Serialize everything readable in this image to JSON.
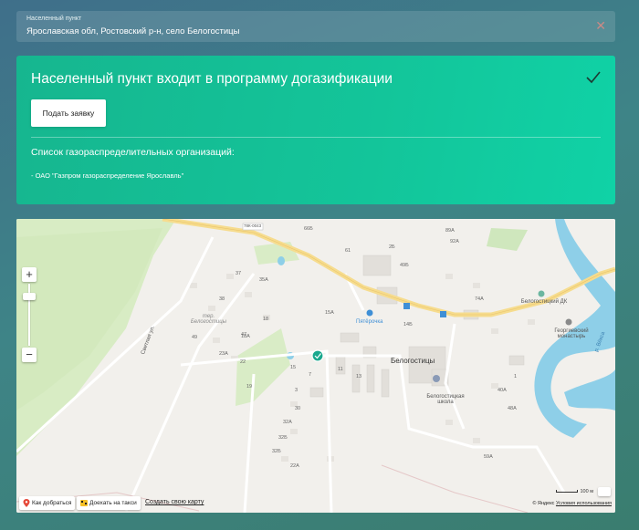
{
  "settlement": {
    "label": "Населенный пункт",
    "value": "Ярославская обл, Ростовский р-н, село Белогостицы",
    "close_icon": "close-icon"
  },
  "program": {
    "title": "Населенный пункт входит в программу догазификации",
    "apply_button": "Подать заявку",
    "list_title": "Список газораспределительных организаций:",
    "organizations": [
      "- ОАО \"Газпром газораспределение Ярославль\""
    ]
  },
  "map": {
    "zoom_in": "+",
    "zoom_out": "−",
    "route_button": "Как добраться",
    "taxi_button": "Доехать на такси",
    "create_map_link": "Создать свою карту",
    "copyright_prefix": "© Яндекс",
    "terms_link": "Условия использования",
    "scale_label": "100 м",
    "labels": {
      "village": "Белогостицы",
      "pyaterochka": "Пятёрочка",
      "school": "Белогостицкая школа",
      "dk": "Белогостицкий ДК",
      "monastery": "Георгиевский монастырь",
      "territory": "тер. Белогостицы",
      "street": "Светлая ул.",
      "river": "р. Вёкса",
      "road": "78К-0043"
    },
    "house_numbers": [
      "37",
      "35А",
      "49",
      "38",
      "47",
      "23А",
      "22",
      "19",
      "18А",
      "18",
      "15",
      "3",
      "7",
      "11",
      "15А",
      "30",
      "32А",
      "32Б",
      "32Б",
      "22А",
      "40А",
      "48А",
      "59А",
      "13",
      "89А",
      "92А",
      "74А",
      "14Б",
      "1",
      "2Б",
      "49Б",
      "61",
      "66Б"
    ]
  },
  "colors": {
    "card": "#13c59a",
    "accent_marker": "#1aa88e",
    "road": "#f6dc8e"
  }
}
